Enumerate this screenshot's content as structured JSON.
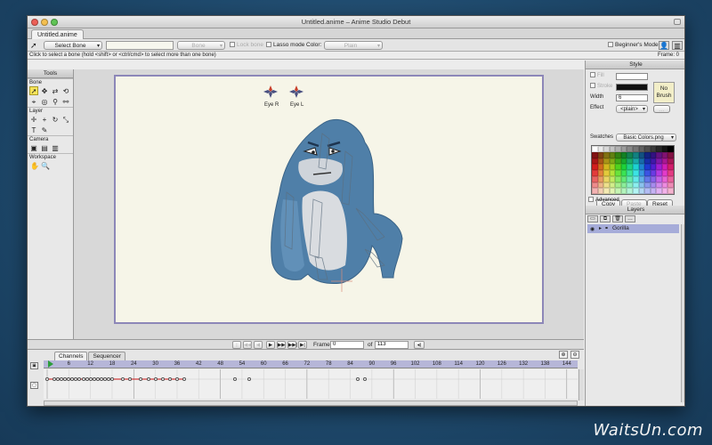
{
  "window": {
    "title": "Untitled.anime – Anime Studio Debut"
  },
  "document_tab": "Untitled.anime",
  "toolbar": {
    "tool_select": "Select Bone",
    "bone_constraints": "Bone Constraints",
    "lock_bone_label": "Lock bone",
    "lasso_mode_label": "Lasso mode",
    "color_label": "Color:",
    "color_value": "Plain",
    "beginners_mode_label": "Beginner's Mode"
  },
  "status": {
    "hint": "Click to select a bone (hold <shift> or <ctrl/cmd> to select more than one bone)",
    "frame_readout": "Frame: 0"
  },
  "tools_panel": {
    "title": "Tools",
    "groups": [
      {
        "label": "Bone",
        "rows": [
          [
            "➚",
            "✥",
            "⇄",
            "⟲"
          ],
          [
            "⌖",
            "◎",
            "⚲",
            "⚯"
          ]
        ]
      },
      {
        "label": "Layer",
        "rows": [
          [
            "✛",
            "+",
            "↻",
            "⤡"
          ],
          [
            "T",
            "✎"
          ]
        ]
      },
      {
        "label": "Camera",
        "rows": [
          [
            "▣",
            "▤",
            "▥"
          ]
        ]
      },
      {
        "label": "Workspace",
        "rows": [
          [
            "✋",
            "🔍"
          ]
        ]
      }
    ]
  },
  "canvas": {
    "bones": [
      {
        "label": "Eye R"
      },
      {
        "label": "Eye L"
      }
    ],
    "character_name": "Gorilla"
  },
  "navigation": {
    "buttons": [
      "|◀◀",
      "◀◀",
      "◀",
      "▶",
      "▶▶",
      "▶▶|",
      "▶|"
    ],
    "frame_label": "Frame",
    "frame_value": "0",
    "of_label": "of",
    "total_frames": "113"
  },
  "timeline": {
    "tabs": [
      "Channels",
      "Sequencer"
    ],
    "ruler_ticks": [
      "6",
      "12",
      "18",
      "24",
      "30",
      "36",
      "42",
      "48",
      "54",
      "60",
      "66",
      "72",
      "78",
      "84",
      "90",
      "96",
      "102",
      "108",
      "114",
      "120",
      "126",
      "132",
      "138",
      "144"
    ],
    "row1_keyframes": [
      0,
      2,
      3,
      4,
      5,
      6,
      7,
      8,
      9,
      10,
      11,
      12,
      13,
      14,
      15,
      16,
      17,
      18,
      21,
      23,
      26,
      28,
      30,
      32,
      34,
      36,
      38
    ],
    "row2_keyframes": [
      52,
      56,
      86,
      88
    ]
  },
  "style_panel": {
    "title": "Style",
    "fill_label": "Fill",
    "stroke_label": "Stroke",
    "no_brush_label": "No\nBrush",
    "width_label": "Width",
    "width_value": "6",
    "effect_label": "Effect",
    "effect_value": "<plain>",
    "swatches_label": "Swatches",
    "swatches_value": "Basic Colors.png",
    "copy_label": "Copy",
    "paste_label": "Paste",
    "reset_label": "Reset",
    "advanced_label": "Advanced"
  },
  "layers_panel": {
    "title": "Layers",
    "layers": [
      {
        "name": "Gorilla"
      }
    ]
  },
  "watermark": "WaitsUn.com",
  "colors": {
    "desktop": "#1f4a6d",
    "stage_bg": "#f6f5e8",
    "stage_border": "#8d87b8",
    "gorilla_body": "#4f7fa8",
    "gorilla_belly": "#d9dce0",
    "selected_layer": "#a6acd9",
    "timeline_ruler": "#b6b6d8"
  }
}
